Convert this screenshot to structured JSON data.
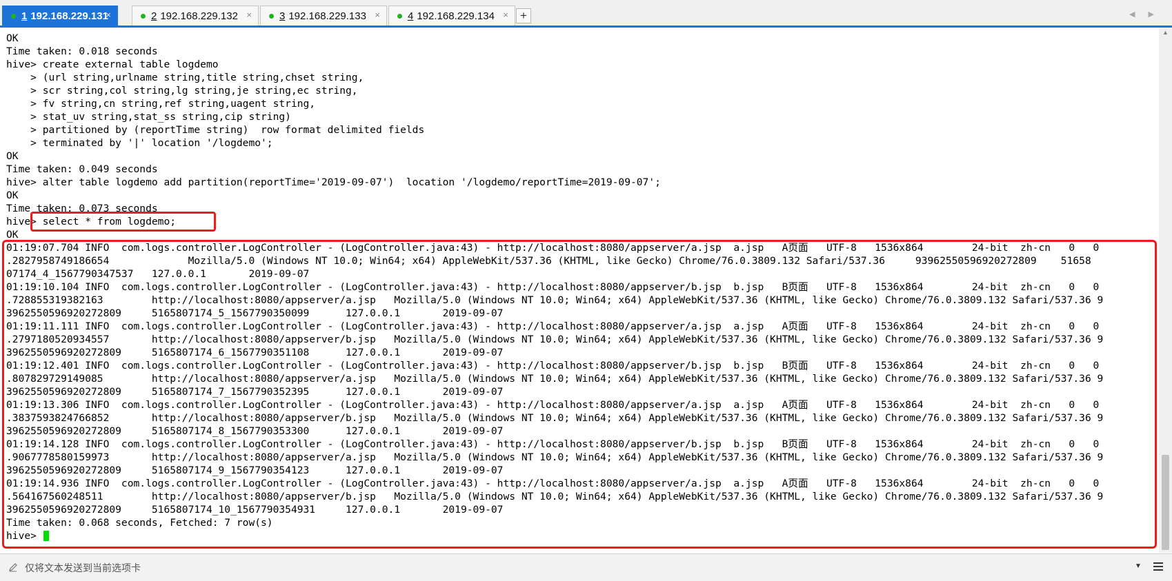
{
  "tabs": [
    {
      "number": "1",
      "label": "192.168.229.131",
      "active": true,
      "close": "×"
    },
    {
      "number": "2",
      "label": "192.168.229.132",
      "active": false,
      "close": "×"
    },
    {
      "number": "3",
      "label": "192.168.229.133",
      "active": false,
      "close": "×"
    },
    {
      "number": "4",
      "label": "192.168.229.134",
      "active": false,
      "close": "×"
    }
  ],
  "new_tab_label": "+",
  "tab_scroll_arrows": "◀ ▶",
  "terminal": {
    "lines": [
      "OK",
      "Time taken: 0.018 seconds",
      "hive> create external table logdemo",
      "    > (url string,urlname string,title string,chset string,",
      "    > scr string,col string,lg string,je string,ec string,",
      "    > fv string,cn string,ref string,uagent string,",
      "    > stat_uv string,stat_ss string,cip string)",
      "    > partitioned by (reportTime string)  row format delimited fields",
      "    > terminated by '|' location '/logdemo';",
      "OK",
      "Time taken: 0.049 seconds",
      "hive> alter table logdemo add partition(reportTime='2019-09-07')  location '/logdemo/reportTime=2019-09-07';",
      "OK",
      "Time taken: 0.073 seconds",
      "hive> select * from logdemo;",
      "OK",
      "01:19:07.704 INFO  com.logs.controller.LogController - (LogController.java:43) - http://localhost:8080/appserver/a.jsp  a.jsp   A页面   UTF-8   1536x864        24-bit  zh-cn   0   0",
      ".2827958749186654             Mozilla/5.0 (Windows NT 10.0; Win64; x64) AppleWebKit/537.36 (KHTML, like Gecko) Chrome/76.0.3809.132 Safari/537.36     93962550596920272809    51658",
      "07174_4_1567790347537   127.0.0.1       2019-09-07",
      "01:19:10.104 INFO  com.logs.controller.LogController - (LogController.java:43) - http://localhost:8080/appserver/b.jsp  b.jsp   B页面   UTF-8   1536x864        24-bit  zh-cn   0   0",
      ".728855319382163        http://localhost:8080/appserver/a.jsp   Mozilla/5.0 (Windows NT 10.0; Win64; x64) AppleWebKit/537.36 (KHTML, like Gecko) Chrome/76.0.3809.132 Safari/537.36 9",
      "3962550596920272809     5165807174_5_1567790350099      127.0.0.1       2019-09-07",
      "01:19:11.111 INFO  com.logs.controller.LogController - (LogController.java:43) - http://localhost:8080/appserver/a.jsp  a.jsp   A页面   UTF-8   1536x864        24-bit  zh-cn   0   0",
      ".2797180520934557       http://localhost:8080/appserver/b.jsp   Mozilla/5.0 (Windows NT 10.0; Win64; x64) AppleWebKit/537.36 (KHTML, like Gecko) Chrome/76.0.3809.132 Safari/537.36 9",
      "3962550596920272809     5165807174_6_1567790351108      127.0.0.1       2019-09-07",
      "01:19:12.401 INFO  com.logs.controller.LogController - (LogController.java:43) - http://localhost:8080/appserver/b.jsp  b.jsp   B页面   UTF-8   1536x864        24-bit  zh-cn   0   0",
      ".807829729149085        http://localhost:8080/appserver/a.jsp   Mozilla/5.0 (Windows NT 10.0; Win64; x64) AppleWebKit/537.36 (KHTML, like Gecko) Chrome/76.0.3809.132 Safari/537.36 9",
      "3962550596920272809     5165807174_7_1567790352395      127.0.0.1       2019-09-07",
      "01:19:13.306 INFO  com.logs.controller.LogController - (LogController.java:43) - http://localhost:8080/appserver/a.jsp  a.jsp   A页面   UTF-8   1536x864        24-bit  zh-cn   0   0",
      ".3837593824766852       http://localhost:8080/appserver/b.jsp   Mozilla/5.0 (Windows NT 10.0; Win64; x64) AppleWebKit/537.36 (KHTML, like Gecko) Chrome/76.0.3809.132 Safari/537.36 9",
      "3962550596920272809     5165807174_8_1567790353300      127.0.0.1       2019-09-07",
      "01:19:14.128 INFO  com.logs.controller.LogController - (LogController.java:43) - http://localhost:8080/appserver/b.jsp  b.jsp   B页面   UTF-8   1536x864        24-bit  zh-cn   0   0",
      ".9067778580159973       http://localhost:8080/appserver/a.jsp   Mozilla/5.0 (Windows NT 10.0; Win64; x64) AppleWebKit/537.36 (KHTML, like Gecko) Chrome/76.0.3809.132 Safari/537.36 9",
      "3962550596920272809     5165807174_9_1567790354123      127.0.0.1       2019-09-07",
      "01:19:14.936 INFO  com.logs.controller.LogController - (LogController.java:43) - http://localhost:8080/appserver/a.jsp  a.jsp   A页面   UTF-8   1536x864        24-bit  zh-cn   0   0",
      ".564167560248511        http://localhost:8080/appserver/b.jsp   Mozilla/5.0 (Windows NT 10.0; Win64; x64) AppleWebKit/537.36 (KHTML, like Gecko) Chrome/76.0.3809.132 Safari/537.36 9",
      "3962550596920272809     5165807174_10_1567790354931     127.0.0.1       2019-09-07",
      "Time taken: 0.068 seconds, Fetched: 7 row(s)"
    ],
    "prompt": "hive> "
  },
  "send_bar": {
    "placeholder": "仅将文本发送到当前选项卡",
    "dropdown_icon": "▼"
  },
  "colors": {
    "accent": "#1e73d8",
    "highlight": "#ee1c1c",
    "cursor": "#00e000",
    "connected_dot": "#1fb51f"
  }
}
